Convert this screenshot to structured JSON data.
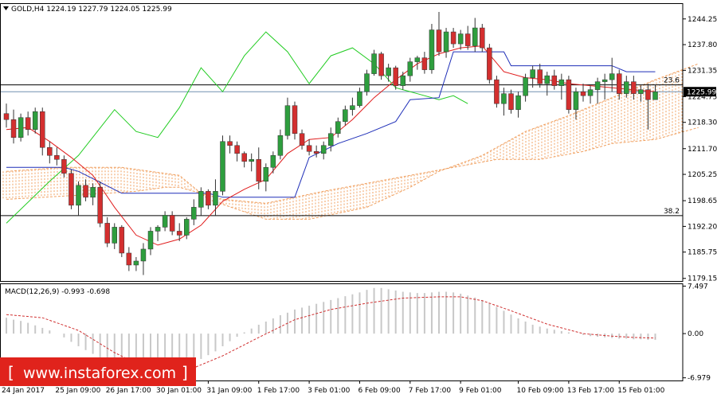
{
  "symbol_header": "GOLD,H4  1224.19 1227.79 1224.05 1225.99",
  "macd_header": "MACD(12,26,9) -0.993 -0.698",
  "watermark": "www.instaforex.com",
  "colors": {
    "bull": "#2e9e3e",
    "bear": "#d32f2f",
    "tenkan": "#e01b1b",
    "kijun": "#1f2fb8",
    "chikou": "#22cc22",
    "cloud": "#f0a060",
    "macd_bar": "#c8c8c8",
    "macd_signal": "#d03030",
    "watermark_bg": "#e0231c"
  },
  "chart_data": [
    {
      "type": "candlestick",
      "title": "",
      "ylim": [
        1178.5,
        1248
      ],
      "y_ticks": [
        "1244.25",
        "1237.80",
        "1231.35",
        "1224.75",
        "1218.30",
        "1211.70",
        "1205.25",
        "1198.65",
        "1192.20",
        "1185.75",
        "1179.15"
      ],
      "x_ticks": [
        "24 Jan 2017",
        "25 Jan 09:00",
        "26 Jan 17:00",
        "30 Jan 01:00",
        "31 Jan 09:00",
        "1 Feb 17:00",
        "3 Feb 01:00",
        "6 Feb 09:00",
        "7 Feb 17:00",
        "9 Feb 01:00",
        "10 Feb 09:00",
        "13 Feb 17:00",
        "15 Feb 01:00"
      ],
      "current_price": "1225.99",
      "levels": [
        {
          "label": "23.6",
          "value": 1227.7
        },
        {
          "label": "38.2",
          "value": 1194.9
        }
      ],
      "candles": [
        [
          1220.5,
          1223,
          1217,
          1219
        ],
        [
          1219,
          1221.5,
          1213,
          1214.5
        ],
        [
          1214.5,
          1220.5,
          1213.5,
          1219.5
        ],
        [
          1219.5,
          1221,
          1215,
          1216.5
        ],
        [
          1216.5,
          1222,
          1215.5,
          1221
        ],
        [
          1221,
          1222,
          1210,
          1212
        ],
        [
          1212,
          1213.5,
          1208,
          1210
        ],
        [
          1210,
          1212,
          1207.5,
          1209
        ],
        [
          1209,
          1210,
          1204.5,
          1205.5
        ],
        [
          1205.5,
          1206.5,
          1196.5,
          1197.5
        ],
        [
          1197.5,
          1203.5,
          1195,
          1202.5
        ],
        [
          1202.5,
          1204,
          1198.5,
          1199.5
        ],
        [
          1199.5,
          1203,
          1197.5,
          1202
        ],
        [
          1202,
          1203.5,
          1192,
          1193
        ],
        [
          1193,
          1194.5,
          1187,
          1188
        ],
        [
          1188,
          1193,
          1186.5,
          1192
        ],
        [
          1192,
          1192.5,
          1184.5,
          1185.5
        ],
        [
          1185.5,
          1187,
          1181,
          1182.5
        ],
        [
          1182.5,
          1184.5,
          1181,
          1183.5
        ],
        [
          1183.5,
          1188,
          1180,
          1186.5
        ],
        [
          1186.5,
          1192,
          1185,
          1191
        ],
        [
          1191,
          1192.5,
          1188.5,
          1192
        ],
        [
          1192,
          1196,
          1191,
          1195
        ],
        [
          1195,
          1196,
          1190,
          1191
        ],
        [
          1191,
          1193,
          1188.5,
          1190
        ],
        [
          1190,
          1194.5,
          1189,
          1194
        ],
        [
          1194,
          1199,
          1192.5,
          1197
        ],
        [
          1197,
          1202,
          1195,
          1201
        ],
        [
          1201,
          1201.5,
          1196.5,
          1197.5
        ],
        [
          1197.5,
          1204,
          1195,
          1201
        ],
        [
          1201,
          1215,
          1200,
          1213.5
        ],
        [
          1213.5,
          1215,
          1210.5,
          1212.5
        ],
        [
          1212.5,
          1213.5,
          1208.5,
          1210.5
        ],
        [
          1210.5,
          1211,
          1207,
          1208.5
        ],
        [
          1208.5,
          1210.5,
          1206,
          1209
        ],
        [
          1209,
          1212,
          1201.5,
          1203.5
        ],
        [
          1203.5,
          1208,
          1201,
          1207
        ],
        [
          1207,
          1211,
          1205.5,
          1210
        ],
        [
          1210,
          1216.5,
          1209,
          1215
        ],
        [
          1215,
          1224.5,
          1214,
          1222.5
        ],
        [
          1222.5,
          1223.5,
          1214,
          1215.5
        ],
        [
          1215.5,
          1216.5,
          1211.5,
          1212.5
        ],
        [
          1212.5,
          1214,
          1210,
          1211
        ],
        [
          1211,
          1212.5,
          1209.5,
          1210.5
        ],
        [
          1210.5,
          1213.5,
          1209,
          1212.5
        ],
        [
          1212.5,
          1217,
          1211,
          1215.5
        ],
        [
          1215.5,
          1219.5,
          1214.5,
          1218.5
        ],
        [
          1218.5,
          1222.5,
          1217.5,
          1221.5
        ],
        [
          1221.5,
          1224.5,
          1220,
          1222.5
        ],
        [
          1222.5,
          1227,
          1222,
          1226
        ],
        [
          1226,
          1231.5,
          1225,
          1230.5
        ],
        [
          1230.5,
          1236.5,
          1230,
          1235.5
        ],
        [
          1235.5,
          1236,
          1229,
          1230
        ],
        [
          1230,
          1233,
          1228.5,
          1232
        ],
        [
          1232,
          1232.5,
          1226.5,
          1227.5
        ],
        [
          1227.5,
          1231,
          1226.5,
          1230
        ],
        [
          1230,
          1234.5,
          1228.5,
          1233.5
        ],
        [
          1233.5,
          1235,
          1231.5,
          1234.5
        ],
        [
          1234.5,
          1236,
          1230.5,
          1231.5
        ],
        [
          1231.5,
          1243,
          1230.5,
          1241.5
        ],
        [
          1241.5,
          1246,
          1235,
          1236
        ],
        [
          1236,
          1242,
          1234.5,
          1241
        ],
        [
          1241,
          1242,
          1237,
          1238
        ],
        [
          1238,
          1241.5,
          1236.5,
          1240.5
        ],
        [
          1240.5,
          1242.5,
          1236.5,
          1237.5
        ],
        [
          1237.5,
          1244.5,
          1236,
          1242
        ],
        [
          1242,
          1243,
          1236,
          1237
        ],
        [
          1237,
          1238,
          1228,
          1229
        ],
        [
          1229,
          1230,
          1222,
          1223
        ],
        [
          1223,
          1227,
          1220,
          1225.5
        ],
        [
          1225.5,
          1226.5,
          1220.5,
          1221.5
        ],
        [
          1221.5,
          1226,
          1219.5,
          1225
        ],
        [
          1225,
          1230.5,
          1223.5,
          1229.5
        ],
        [
          1229.5,
          1232.5,
          1227,
          1231.5
        ],
        [
          1231.5,
          1233,
          1227,
          1228
        ],
        [
          1228,
          1231,
          1225,
          1230
        ],
        [
          1230,
          1231.5,
          1226.5,
          1227.5
        ],
        [
          1227.5,
          1230.5,
          1224,
          1229
        ],
        [
          1229,
          1230,
          1220.5,
          1221.5
        ],
        [
          1221.5,
          1227,
          1219,
          1226
        ],
        [
          1226,
          1228,
          1223.5,
          1225
        ],
        [
          1225,
          1227.5,
          1223,
          1226.5
        ],
        [
          1226.5,
          1229.5,
          1223,
          1228.5
        ],
        [
          1228.5,
          1230.5,
          1224,
          1229
        ],
        [
          1229,
          1234.5,
          1226,
          1230.5
        ],
        [
          1230.5,
          1231.5,
          1224,
          1225.5
        ],
        [
          1225.5,
          1230,
          1224.5,
          1228.5
        ],
        [
          1228.5,
          1230,
          1224,
          1225.5
        ],
        [
          1225.5,
          1227.5,
          1223.5,
          1226.5
        ],
        [
          1226.5,
          1228,
          1216.5,
          1224
        ],
        [
          1224,
          1227.8,
          1224,
          1225.99
        ]
      ],
      "tenkan": [
        [
          0,
          1216.5
        ],
        [
          3,
          1217
        ],
        [
          6,
          1213.5
        ],
        [
          9,
          1209.5
        ],
        [
          12,
          1205
        ],
        [
          15,
          1197
        ],
        [
          18,
          1190
        ],
        [
          21,
          1187.5
        ],
        [
          24,
          1189
        ],
        [
          27,
          1192.5
        ],
        [
          30,
          1198.5
        ],
        [
          33,
          1201.5
        ],
        [
          36,
          1204
        ],
        [
          39,
          1210.5
        ],
        [
          42,
          1214
        ],
        [
          45,
          1214.5
        ],
        [
          48,
          1219
        ],
        [
          51,
          1224.5
        ],
        [
          54,
          1229
        ],
        [
          57,
          1233
        ],
        [
          60,
          1235.5
        ],
        [
          63,
          1237
        ],
        [
          66,
          1237.5
        ],
        [
          69,
          1231
        ],
        [
          72,
          1229.5
        ],
        [
          75,
          1229
        ],
        [
          78,
          1228
        ],
        [
          81,
          1227.5
        ],
        [
          84,
          1227
        ],
        [
          87,
          1226.5
        ],
        [
          90,
          1226
        ]
      ],
      "kijun": [
        [
          0,
          1207
        ],
        [
          8,
          1207
        ],
        [
          10,
          1206
        ],
        [
          16,
          1200.5
        ],
        [
          28,
          1200.5
        ],
        [
          30,
          1199.5
        ],
        [
          40,
          1199.5
        ],
        [
          42,
          1209.5
        ],
        [
          46,
          1213
        ],
        [
          50,
          1215.5
        ],
        [
          54,
          1218.5
        ],
        [
          56,
          1224
        ],
        [
          60,
          1224.5
        ],
        [
          62,
          1236
        ],
        [
          69,
          1236
        ],
        [
          70,
          1232.5
        ],
        [
          84,
          1232.5
        ],
        [
          86,
          1231
        ],
        [
          90,
          1231
        ]
      ],
      "chikou": [
        [
          0,
          1193
        ],
        [
          6,
          1203.5
        ],
        [
          10,
          1210
        ],
        [
          15,
          1221.5
        ],
        [
          18,
          1216
        ],
        [
          21,
          1214.5
        ],
        [
          24,
          1222
        ],
        [
          27,
          1232
        ],
        [
          30,
          1226
        ],
        [
          33,
          1235
        ],
        [
          36,
          1241
        ],
        [
          39,
          1236
        ],
        [
          42,
          1228
        ],
        [
          45,
          1235
        ],
        [
          48,
          1237
        ],
        [
          51,
          1233
        ],
        [
          54,
          1227
        ],
        [
          57,
          1225.5
        ],
        [
          60,
          1224
        ],
        [
          62,
          1225
        ],
        [
          64,
          1223
        ]
      ],
      "span_a": [
        [
          0,
          1206
        ],
        [
          8,
          1207
        ],
        [
          16,
          1207
        ],
        [
          24,
          1205
        ],
        [
          28,
          1199
        ],
        [
          36,
          1194
        ],
        [
          42,
          1194
        ],
        [
          50,
          1197
        ],
        [
          56,
          1202
        ],
        [
          60,
          1206
        ],
        [
          66,
          1210
        ],
        [
          72,
          1216
        ],
        [
          78,
          1220
        ],
        [
          84,
          1224.5
        ],
        [
          90,
          1229
        ],
        [
          96,
          1233
        ]
      ],
      "span_b": [
        [
          0,
          1199
        ],
        [
          10,
          1200
        ],
        [
          18,
          1201
        ],
        [
          22,
          1202
        ],
        [
          24,
          1202
        ],
        [
          30,
          1199
        ],
        [
          36,
          1198
        ],
        [
          44,
          1201
        ],
        [
          50,
          1203
        ],
        [
          56,
          1205
        ],
        [
          62,
          1207
        ],
        [
          68,
          1209
        ],
        [
          74,
          1209
        ],
        [
          80,
          1211
        ],
        [
          84,
          1213
        ],
        [
          90,
          1214
        ],
        [
          96,
          1217
        ]
      ]
    },
    {
      "type": "bar",
      "title": "MACD(12,26,9)",
      "ylim": [
        -7.4,
        7.8
      ],
      "y_ticks": [
        "7.497",
        "0.00",
        "-6.979"
      ],
      "histogram": [
        2.5,
        2.2,
        2,
        1.7,
        1.3,
        0.9,
        0.5,
        0,
        -0.6,
        -1.3,
        -2,
        -2.6,
        -3.2,
        -3.8,
        -4.3,
        -4.8,
        -5.3,
        -5.8,
        -6.2,
        -6.4,
        -6.4,
        -6.3,
        -6.1,
        -5.8,
        -5.4,
        -5,
        -4.5,
        -4,
        -3.4,
        -2.8,
        -2,
        -1.2,
        -0.5,
        0.2,
        0.8,
        1.4,
        1.9,
        2.4,
        2.9,
        3.3,
        3.8,
        4.1,
        4.4,
        4.7,
        5,
        5.3,
        5.6,
        5.9,
        6.2,
        6.5,
        6.9,
        7.2,
        7.2,
        7,
        6.8,
        6.6,
        6.5,
        6.4,
        6.4,
        6.5,
        6.6,
        6.6,
        6.5,
        6.3,
        6,
        5.7,
        5.3,
        4.8,
        4.2,
        3.6,
        3,
        2.4,
        1.9,
        1.4,
        1.1,
        0.8,
        0.6,
        0.4,
        0.2,
        0,
        -0.2,
        -0.4,
        -0.5,
        -0.6,
        -0.7,
        -0.8,
        -0.8,
        -0.9,
        -0.9,
        -1,
        -1
      ],
      "signal": [
        [
          0,
          3
        ],
        [
          5,
          2.5
        ],
        [
          10,
          0.5
        ],
        [
          15,
          -3
        ],
        [
          20,
          -5.8
        ],
        [
          23,
          -6.2
        ],
        [
          26,
          -5.4
        ],
        [
          30,
          -3.5
        ],
        [
          35,
          -0.6
        ],
        [
          40,
          2.2
        ],
        [
          45,
          3.8
        ],
        [
          50,
          4.8
        ],
        [
          55,
          5.6
        ],
        [
          60,
          5.8
        ],
        [
          63,
          5.8
        ],
        [
          66,
          5.2
        ],
        [
          70,
          3.6
        ],
        [
          75,
          1.5
        ],
        [
          80,
          0
        ],
        [
          84,
          -0.4
        ],
        [
          87,
          -0.6
        ],
        [
          90,
          -0.7
        ]
      ]
    }
  ]
}
